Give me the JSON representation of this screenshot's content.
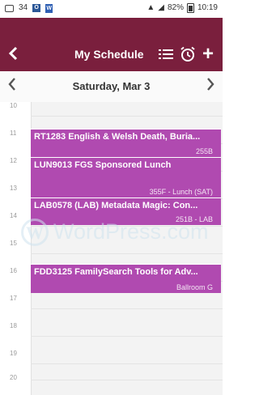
{
  "status_bar": {
    "left_badge": "34",
    "battery_pct": "82%",
    "time": "10:19"
  },
  "app_bar": {
    "title": "My Schedule",
    "back_glyph": "‹",
    "add_glyph": "+"
  },
  "date_nav": {
    "date": "Saturday, Mar 3",
    "prev_glyph": "‹",
    "next_glyph": "›"
  },
  "hours": [
    "10",
    "11",
    "12",
    "13",
    "14",
    "15",
    "16",
    "17",
    "18",
    "19",
    "20"
  ],
  "events": [
    {
      "title": "RT1283 English & Welsh Death, Buria...",
      "room": "255B",
      "color": "#b04ab0"
    },
    {
      "title": "LUN9013 FGS Sponsored Lunch",
      "room": "355F - Lunch (SAT)",
      "color": "#b04ab0"
    },
    {
      "title": "LAB0578 (LAB) Metadata Magic: Con...",
      "room": "251B - LAB",
      "color": "#b04ab0"
    },
    {
      "title": "FDD3125 FamilySearch Tools for Adv...",
      "room": "Ballroom G",
      "color": "#b04ab0"
    }
  ],
  "watermark": {
    "logo_letter": "W",
    "text": "WordPress.com"
  },
  "colors": {
    "brand": "#7a1f3d",
    "event": "#b04ab0"
  }
}
